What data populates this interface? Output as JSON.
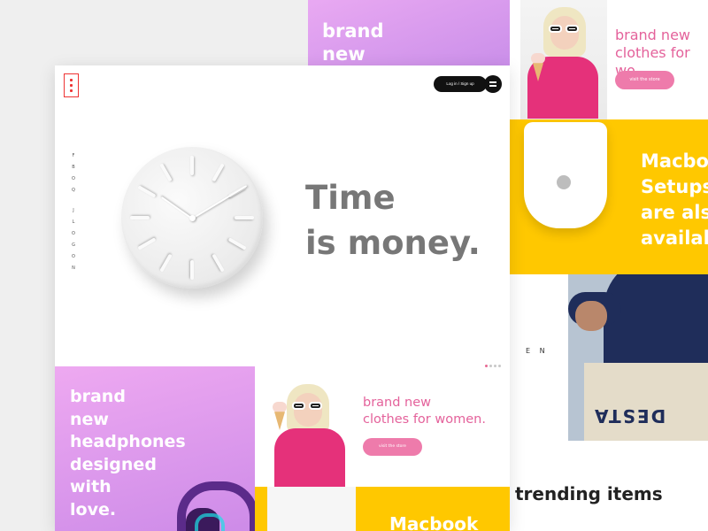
{
  "background_page": {
    "purple_panel_text": "brand\nnew",
    "promo": {
      "title": "brand new\nclothes for wo",
      "button_label": "visit the store"
    },
    "yellow_panel_text": "Macbo\nSetups\nare als\navailab",
    "brand_letters": "E N",
    "bag_print": "DESTA",
    "trending_heading": "trending items"
  },
  "foreground_page": {
    "header": {
      "login_label": "Log in / Sign up"
    },
    "side_nav": [
      "F",
      "B",
      "O",
      "Q",
      "J",
      "L",
      "O",
      "G",
      "O",
      "N"
    ],
    "hero": {
      "title_line1": "Time",
      "title_line2": "is money."
    },
    "slider": {
      "total": 4,
      "active_index": 0
    },
    "purple_panel_text": "brand\nnew\nheadphones\ndesigned\nwith\nlove.",
    "promo": {
      "title": "brand new\nclothes for women.",
      "button_label": "visit the store"
    },
    "yellow_panel_text": "Macbook"
  },
  "colors": {
    "accent_pink": "#ee7bab",
    "promo_text_pink": "#e4629b",
    "purple": "#d393ec",
    "yellow": "#ffc800",
    "logo_red": "#ee3333"
  },
  "icons": [
    "menu-icon",
    "apple-logo-icon",
    "logo-icon"
  ]
}
